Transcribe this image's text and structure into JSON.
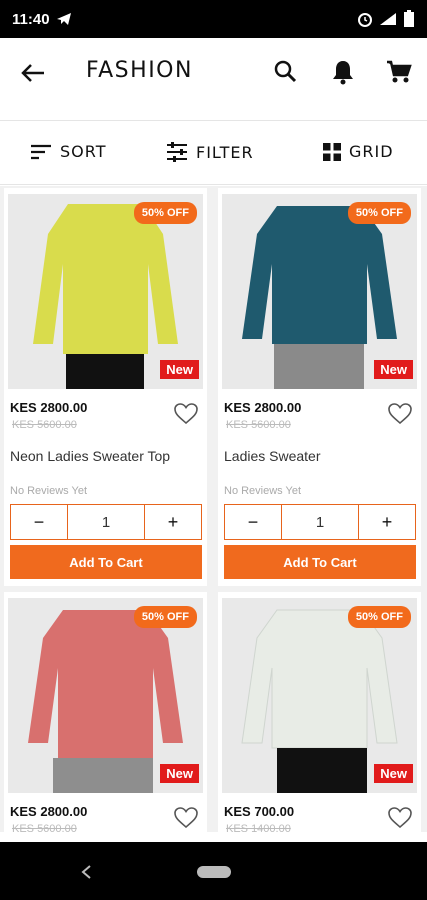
{
  "status": {
    "time": "11:40"
  },
  "header": {
    "title": "FASHION"
  },
  "toolbar": {
    "sort": "SORT",
    "filter": "FILTER",
    "grid": "GRID"
  },
  "products": [
    {
      "price": "KES 2800.00",
      "old_price": "KES 5600.00",
      "name": "Neon Ladies Sweater Top",
      "reviews": "No Reviews Yet",
      "badge": "50% OFF",
      "new": "New",
      "qty": "1",
      "add": "Add To Cart",
      "color": "#d9dc4c"
    },
    {
      "price": "KES 2800.00",
      "old_price": "KES 5600.00",
      "name": "Ladies Sweater",
      "reviews": "No Reviews Yet",
      "badge": "50% OFF",
      "new": "New",
      "qty": "1",
      "add": "Add To Cart",
      "color": "#1f5a6e"
    },
    {
      "price": "KES 2800.00",
      "old_price": "KES 5600.00",
      "badge": "50% OFF",
      "new": "New",
      "color": "#d8706e"
    },
    {
      "price": "KES 700.00",
      "old_price": "KES 1400.00",
      "badge": "50% OFF",
      "new": "New",
      "color": "#e8ece6"
    }
  ],
  "colors": {
    "accent": "#f06a1e",
    "new_badge": "#e11b1b"
  }
}
